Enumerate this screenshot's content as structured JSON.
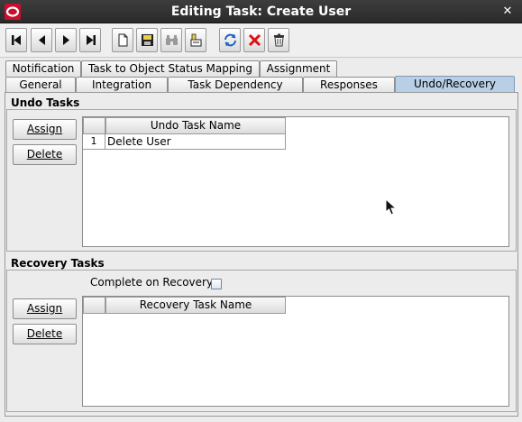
{
  "window": {
    "title": "Editing Task: Create User",
    "close_glyph": "✕"
  },
  "toolbar": {
    "buttons": [
      {
        "name": "first-record-icon"
      },
      {
        "name": "previous-record-icon"
      },
      {
        "name": "next-record-icon"
      },
      {
        "name": "last-record-icon"
      },
      {
        "name": "new-icon"
      },
      {
        "name": "save-icon"
      },
      {
        "name": "find-icon"
      },
      {
        "name": "edit-icon"
      },
      {
        "name": "refresh-icon"
      },
      {
        "name": "delete-icon"
      },
      {
        "name": "trash-icon"
      }
    ]
  },
  "tabs": {
    "row1": [
      "Notification",
      "Task to Object Status Mapping",
      "Assignment"
    ],
    "row2": [
      "General",
      "Integration",
      "Task Dependency",
      "Responses",
      "Undo/Recovery"
    ],
    "selected": "Undo/Recovery"
  },
  "undo": {
    "title": "Undo Tasks",
    "assign_label": "Assign",
    "delete_label": "Delete",
    "column_header": "Undo Task Name",
    "rows": [
      {
        "num": "1",
        "name": "Delete User"
      }
    ]
  },
  "recovery": {
    "title": "Recovery Tasks",
    "complete_label": "Complete on Recovery",
    "complete_checked": false,
    "assign_label": "Assign",
    "delete_label": "Delete",
    "column_header": "Recovery Task Name",
    "rows": []
  },
  "colors": {
    "titlebar": "#2f2f2f",
    "selected_tab": "#b8cfe5",
    "delete_red": "#e01010",
    "brand_red": "#c8102e"
  }
}
